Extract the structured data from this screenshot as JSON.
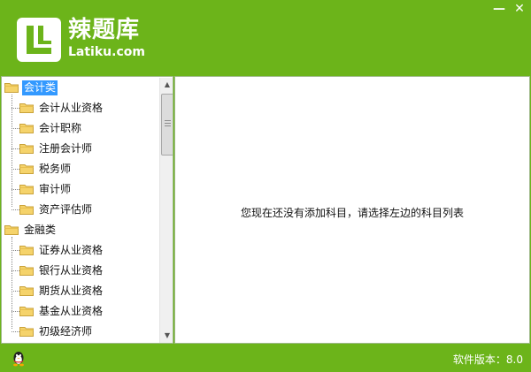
{
  "header": {
    "brand_name": "辣题库",
    "brand_url": "Latiku.com",
    "minimize_label": "—",
    "close_label": "✕"
  },
  "tree": {
    "categories": [
      {
        "label": "会计类",
        "selected": true,
        "children": [
          "会计从业资格",
          "会计职称",
          "注册会计师",
          "税务师",
          "审计师",
          "资产评估师"
        ]
      },
      {
        "label": "金融类",
        "selected": false,
        "children": [
          "证券从业资格",
          "银行从业资格",
          "期货从业资格",
          "基金从业资格",
          "初级经济师"
        ]
      }
    ]
  },
  "scrollbar": {
    "up_arrow": "▲",
    "down_arrow": "▼"
  },
  "main": {
    "empty_message": "您现在还没有添加科目，请选择左边的科目列表"
  },
  "status": {
    "version_text": "软件版本：8.0",
    "qq_icon": "qq-penguin-icon"
  },
  "colors": {
    "brand_green": "#6cb41a",
    "selection_blue": "#3399ff",
    "folder_yellow": "#f5d36b"
  }
}
